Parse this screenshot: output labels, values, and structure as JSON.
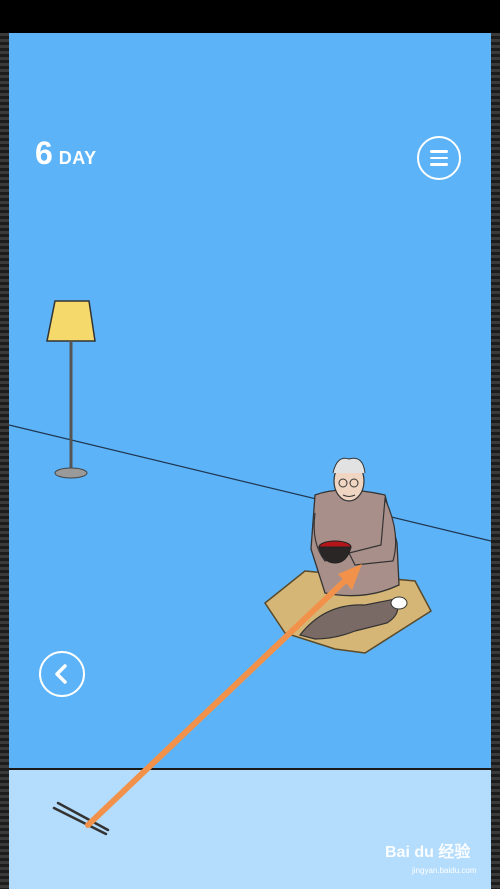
{
  "game": {
    "day_number": "6",
    "day_label": "DAY"
  },
  "icons": {
    "menu": "hamburger-menu-icon",
    "back": "chevron-left-icon"
  },
  "watermark": {
    "brand": "Bai du 经验",
    "url": "jingyan.baidu.com"
  },
  "colors": {
    "wall": "#5cb3f7",
    "floor_strip": "#b3dcfd",
    "arrow": "#f2924a",
    "lamp_shade": "#f5d96a",
    "mat": "#d6b676"
  }
}
